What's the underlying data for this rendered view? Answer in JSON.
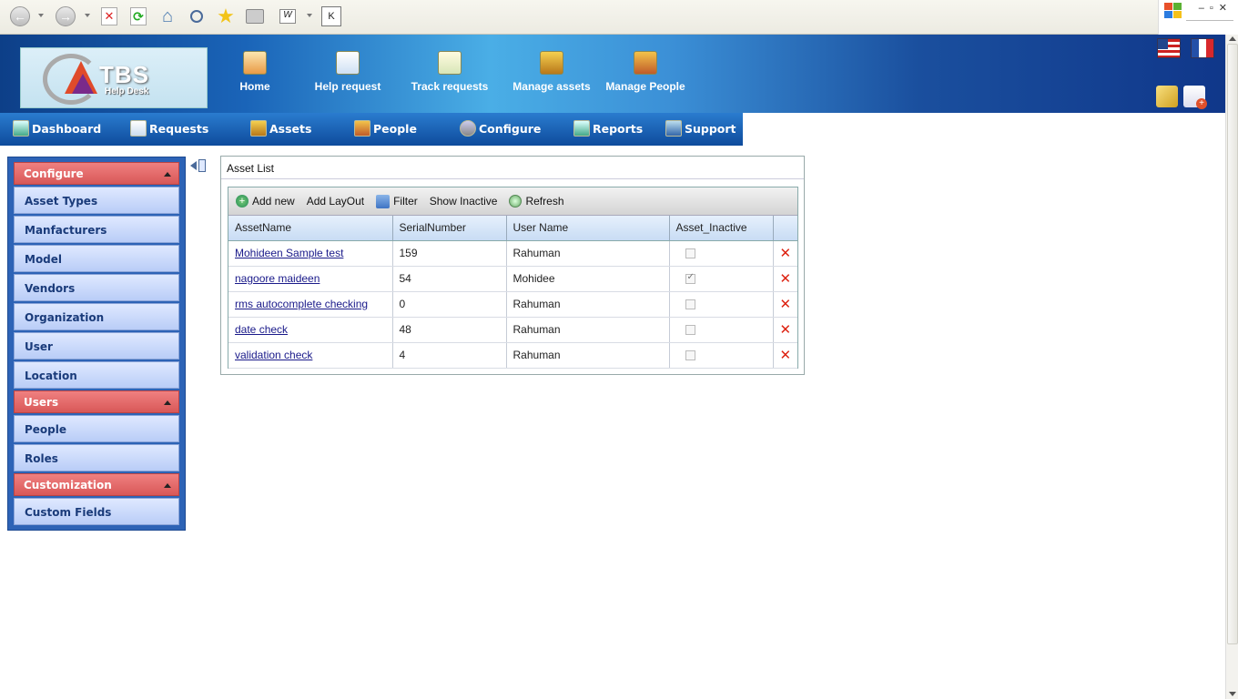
{
  "browser": {
    "address_letter": "K",
    "icons": [
      "back-icon",
      "forward-icon",
      "stop-icon",
      "refresh-icon",
      "home-icon",
      "search-icon",
      "favorites-icon",
      "print-icon",
      "word-icon"
    ]
  },
  "app": {
    "logo_text": "TBS",
    "logo_sub": "Help Desk",
    "top_nav": [
      {
        "label": "Home",
        "icon": "home-icon"
      },
      {
        "label": "Help request",
        "icon": "help-request-icon"
      },
      {
        "label": "Track requests",
        "icon": "track-requests-icon"
      },
      {
        "label": "Manage assets",
        "icon": "manage-assets-icon"
      },
      {
        "label": "Manage People",
        "icon": "manage-people-icon"
      }
    ],
    "menu": [
      {
        "label": "Dashboard"
      },
      {
        "label": "Requests"
      },
      {
        "label": "Assets"
      },
      {
        "label": "People"
      },
      {
        "label": "Configure"
      },
      {
        "label": "Reports"
      },
      {
        "label": "Support"
      }
    ]
  },
  "sidebar": {
    "sections": [
      {
        "title": "Configure",
        "items": [
          "Asset Types",
          "Manfacturers",
          "Model",
          "Vendors",
          "Organization",
          "User",
          "Location"
        ]
      },
      {
        "title": "Users",
        "items": [
          "People",
          "Roles"
        ]
      },
      {
        "title": "Customization",
        "items": [
          "Custom Fields"
        ]
      }
    ]
  },
  "asset_panel": {
    "title": "Asset List",
    "toolbar": {
      "add_new": "Add new",
      "add_layout": "Add LayOut",
      "filter": "Filter",
      "show_inactive": "Show Inactive",
      "refresh": "Refresh"
    },
    "columns": [
      "AssetName",
      "SerialNumber",
      "User Name",
      "Asset_Inactive"
    ],
    "rows": [
      {
        "name": "Mohideen Sample test",
        "serial": "159",
        "user": "Rahuman",
        "inactive": false
      },
      {
        "name": "nagoore maideen",
        "serial": "54",
        "user": "Mohidee",
        "inactive": true
      },
      {
        "name": "rms autocomplete checking",
        "serial": "0",
        "user": "Rahuman",
        "inactive": false
      },
      {
        "name": "date check",
        "serial": "48",
        "user": "Rahuman",
        "inactive": false
      },
      {
        "name": "validation check",
        "serial": "4",
        "user": "Rahuman",
        "inactive": false
      }
    ]
  },
  "colors": {
    "header_blue": "#1a64b8",
    "sidebar_header": "#d85858",
    "sidebar_item": "#c9d9fb",
    "delete_red": "#d21f1f"
  }
}
